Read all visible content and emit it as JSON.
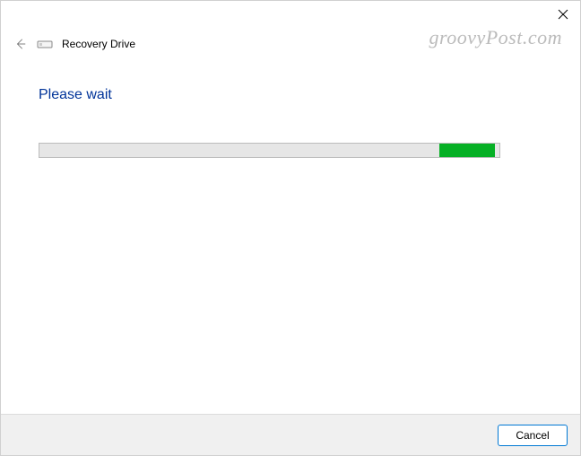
{
  "header": {
    "app_title": "Recovery Drive"
  },
  "content": {
    "heading": "Please wait"
  },
  "progress": {
    "fill_left_percent": 87,
    "fill_width_percent": 12
  },
  "footer": {
    "cancel_label": "Cancel"
  },
  "watermark": {
    "text": "groovyPost.com"
  }
}
